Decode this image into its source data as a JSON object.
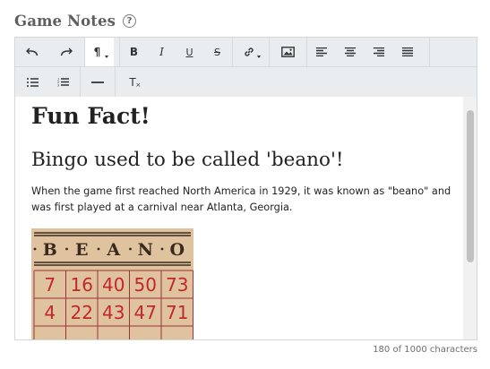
{
  "field": {
    "label": "Game Notes",
    "help_icon": "?"
  },
  "toolbar": {
    "row1": [
      {
        "icon": "undo-icon"
      },
      {
        "icon": "redo-icon"
      },
      {
        "icon": "paragraph-format-icon",
        "selected": true
      },
      {
        "icon": "bold-icon"
      },
      {
        "icon": "italic-icon"
      },
      {
        "icon": "underline-icon"
      },
      {
        "icon": "strikethrough-icon"
      },
      {
        "icon": "link-icon"
      },
      {
        "icon": "image-icon"
      },
      {
        "icon": "align-left-icon"
      },
      {
        "icon": "align-center-icon"
      },
      {
        "icon": "align-right-icon"
      },
      {
        "icon": "justify-icon"
      }
    ],
    "row2": [
      {
        "icon": "bulleted-list-icon"
      },
      {
        "icon": "numbered-list-icon"
      },
      {
        "icon": "horizontal-line-icon"
      },
      {
        "icon": "clear-formatting-icon"
      }
    ],
    "paragraph_glyph": "¶",
    "bold_glyph": "B",
    "italic_glyph": "I",
    "underline_glyph": "U",
    "strike_glyph": "S",
    "clear_glyph": "T"
  },
  "content": {
    "heading": "Fun Fact!",
    "subheading": "Bingo used to be called 'beano'!",
    "paragraph": "When the game first reached North America in 1929, it was known as \"beano\" and was first played at a carnival near Atlanta, Georgia.",
    "card": {
      "header_letters": [
        "B",
        "E",
        "A",
        "N",
        "O"
      ],
      "rows": [
        [
          "7",
          "16",
          "40",
          "50",
          "73"
        ],
        [
          "4",
          "22",
          "43",
          "47",
          "71"
        ]
      ]
    }
  },
  "footer": {
    "char_count": "180 of 1000 characters"
  },
  "colors": {
    "toolbar_bg": "#e9edef",
    "card_paper": "#e2c8a6",
    "card_numbers": "#c4262e",
    "card_header_ink": "#3a2a1e"
  }
}
